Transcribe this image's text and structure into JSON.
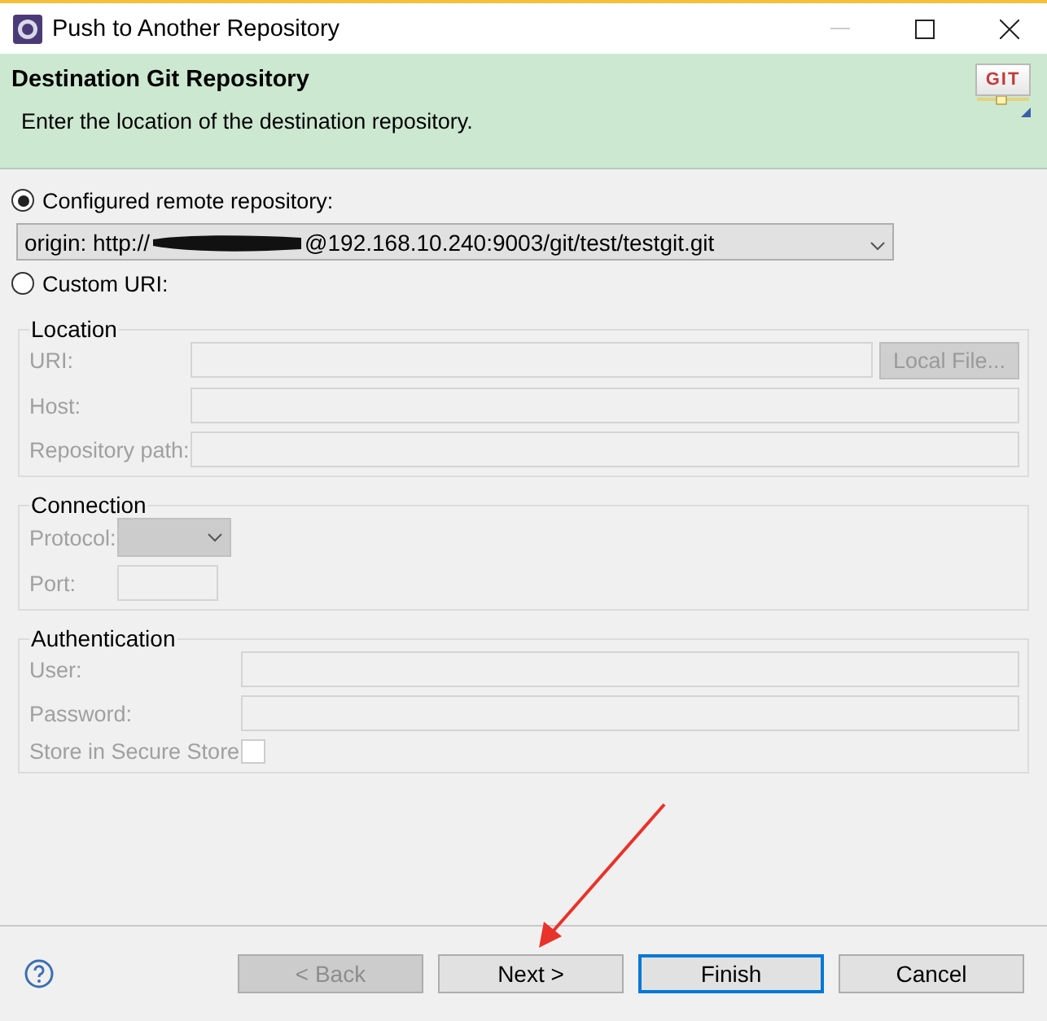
{
  "window": {
    "title": "Push to Another Repository"
  },
  "header": {
    "title": "Destination Git Repository",
    "description": "Enter the location of the destination repository.",
    "logo_text": "GIT"
  },
  "source_options": [
    {
      "label": "Configured remote repository:",
      "selected": true
    },
    {
      "label": "Custom URI:",
      "selected": false
    }
  ],
  "remote": {
    "prefix": "origin: http://",
    "suffix": "@192.168.10.240:9003/git/test/testgit.git"
  },
  "groups": [
    {
      "title": "Location",
      "disabled": true,
      "fields": [
        {
          "label": "URI:",
          "kind": "text_button",
          "button": "Local File..."
        },
        {
          "label": "Host:",
          "kind": "text"
        },
        {
          "label": "Repository path:",
          "kind": "text"
        }
      ]
    },
    {
      "title": "Connection",
      "disabled": true,
      "fields": [
        {
          "label": "Protocol:",
          "kind": "select"
        },
        {
          "label": "Port:",
          "kind": "short"
        }
      ]
    },
    {
      "title": "Authentication",
      "disabled": true,
      "fields": [
        {
          "label": "User:",
          "kind": "text"
        },
        {
          "label": "Password:",
          "kind": "text"
        },
        {
          "label": "Store in Secure Store",
          "kind": "checkbox",
          "checked": false
        }
      ]
    }
  ],
  "buttons": [
    {
      "label": "< Back",
      "disabled": true,
      "default": false
    },
    {
      "label": "Next >",
      "disabled": false,
      "default": false
    },
    {
      "label": "Finish",
      "disabled": false,
      "default": true
    },
    {
      "label": "Cancel",
      "disabled": false,
      "default": false
    }
  ]
}
